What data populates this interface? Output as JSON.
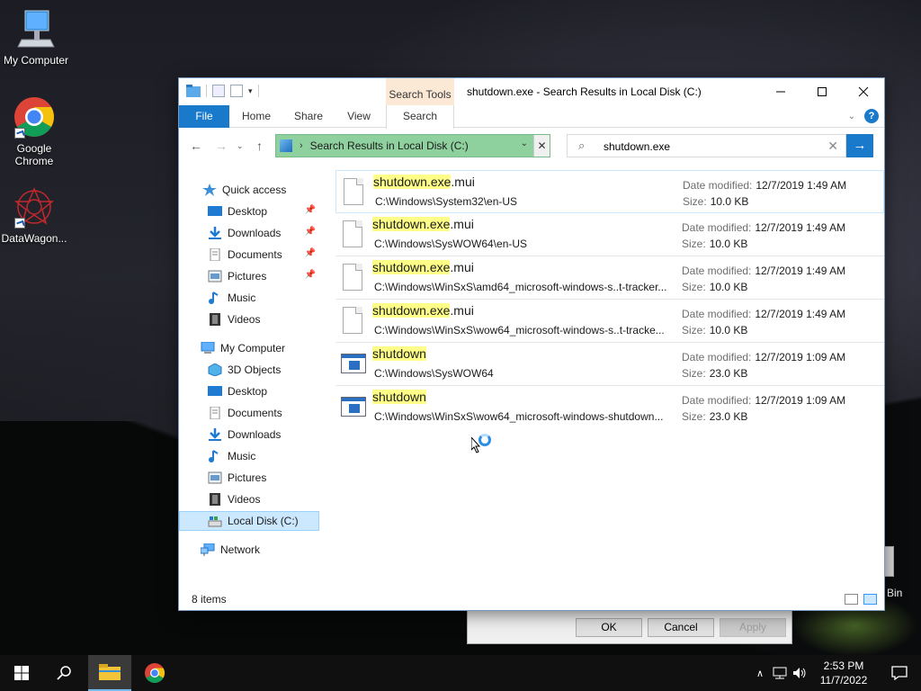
{
  "desktop": {
    "icons": [
      {
        "label": "My Computer"
      },
      {
        "label": "Google Chrome"
      },
      {
        "label": "DataWagon..."
      }
    ],
    "recycle_bin_label": "Bin"
  },
  "window": {
    "title": "shutdown.exe - Search Results in Local Disk (C:)",
    "context_tab": "Search Tools",
    "tabs": [
      "File",
      "Home",
      "Share",
      "View",
      "Search"
    ],
    "address": "Search Results in Local Disk (C:)",
    "search_value": "shutdown.exe",
    "nav": {
      "quick_access": "Quick access",
      "quick_items": [
        {
          "label": "Desktop",
          "icon": "desktop-icon"
        },
        {
          "label": "Downloads",
          "icon": "download-icon"
        },
        {
          "label": "Documents",
          "icon": "documents-icon"
        },
        {
          "label": "Pictures",
          "icon": "pictures-icon"
        },
        {
          "label": "Music",
          "icon": "music-icon"
        },
        {
          "label": "Videos",
          "icon": "videos-icon"
        }
      ],
      "this_pc": "My Computer",
      "pc_items": [
        {
          "label": "3D Objects"
        },
        {
          "label": "Desktop"
        },
        {
          "label": "Documents"
        },
        {
          "label": "Downloads"
        },
        {
          "label": "Music"
        },
        {
          "label": "Pictures"
        },
        {
          "label": "Videos"
        },
        {
          "label": "Local Disk (C:)"
        }
      ],
      "network": "Network"
    },
    "results": [
      {
        "hl": "shutdown.exe",
        "rest": ".mui",
        "path": "C:\\Windows\\System32\\en-US",
        "date_label": "Date modified:",
        "date": "12/7/2019 1:49 AM",
        "size_label": "Size:",
        "size": "10.0 KB",
        "type": "doc"
      },
      {
        "hl": "shutdown.exe",
        "rest": ".mui",
        "path": "C:\\Windows\\SysWOW64\\en-US",
        "date_label": "Date modified:",
        "date": "12/7/2019 1:49 AM",
        "size_label": "Size:",
        "size": "10.0 KB",
        "type": "doc"
      },
      {
        "hl": "shutdown.exe",
        "rest": ".mui",
        "path": "C:\\Windows\\WinSxS\\amd64_microsoft-windows-s..t-tracker...",
        "date_label": "Date modified:",
        "date": "12/7/2019 1:49 AM",
        "size_label": "Size:",
        "size": "10.0 KB",
        "type": "doc"
      },
      {
        "hl": "shutdown.exe",
        "rest": ".mui",
        "path": "C:\\Windows\\WinSxS\\wow64_microsoft-windows-s..t-tracke...",
        "date_label": "Date modified:",
        "date": "12/7/2019 1:49 AM",
        "size_label": "Size:",
        "size": "10.0 KB",
        "type": "doc"
      },
      {
        "hl": "shutdown",
        "rest": "",
        "path": "C:\\Windows\\SysWOW64",
        "date_label": "Date modified:",
        "date": "12/7/2019 1:09 AM",
        "size_label": "Size:",
        "size": "23.0 KB",
        "type": "exe"
      },
      {
        "hl": "shutdown",
        "rest": "",
        "path": "C:\\Windows\\WinSxS\\wow64_microsoft-windows-shutdown...",
        "date_label": "Date modified:",
        "date": "12/7/2019 1:09 AM",
        "size_label": "Size:",
        "size": "23.0 KB",
        "type": "exe"
      }
    ],
    "status": "8 items"
  },
  "dialog": {
    "ok": "OK",
    "cancel": "Cancel",
    "apply": "Apply"
  },
  "taskbar": {
    "time": "2:53 PM",
    "date": "11/7/2022"
  },
  "colors": {
    "accent": "#1979ca",
    "address_bg": "#8fd19e",
    "highlight": "#ffff88",
    "context_tab_bg": "#fbe9d6"
  }
}
